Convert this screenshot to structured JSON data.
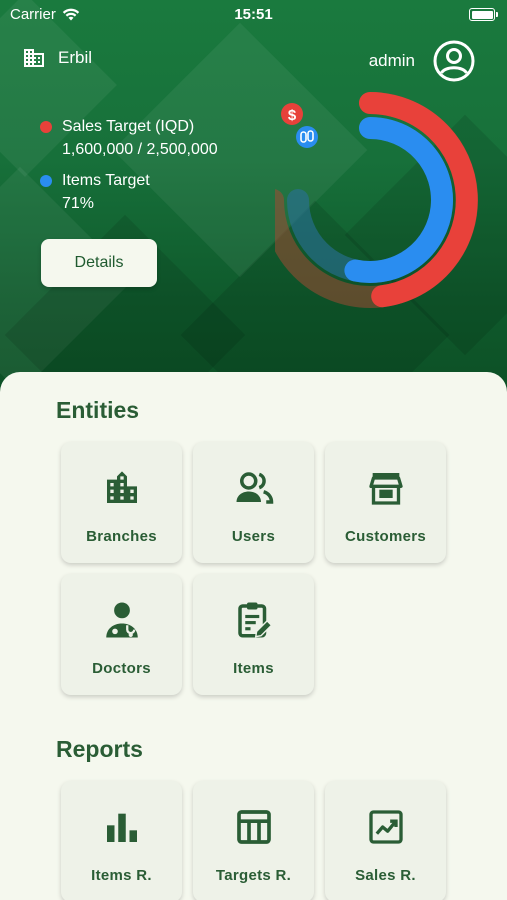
{
  "status_bar": {
    "carrier": "Carrier",
    "time": "15:51"
  },
  "header": {
    "branch": "Erbil",
    "username": "admin"
  },
  "targets": {
    "sales": {
      "label": "Sales Target (IQD)",
      "value": "1,600,000 / 2,500,000",
      "color": "#e8413a",
      "progress": 0.64
    },
    "items": {
      "label": "Items Target",
      "value": "71%",
      "color": "#2a8df0",
      "progress": 0.71
    },
    "details_button": "Details"
  },
  "entities": {
    "title": "Entities",
    "tiles": [
      {
        "label": "Branches",
        "icon": "building-icon"
      },
      {
        "label": "Users",
        "icon": "users-icon"
      },
      {
        "label": "Customers",
        "icon": "store-icon"
      },
      {
        "label": "Doctors",
        "icon": "doctor-icon"
      },
      {
        "label": "Items",
        "icon": "clipboard-edit-icon"
      }
    ]
  },
  "reports": {
    "title": "Reports",
    "tiles": [
      {
        "label": "Items R.",
        "icon": "bar-chart-icon"
      },
      {
        "label": "Targets R.",
        "icon": "table-icon"
      },
      {
        "label": "Sales R.",
        "icon": "trending-up-icon"
      }
    ]
  },
  "colors": {
    "primary": "#1a7a3e",
    "tile_text": "#2a5d35",
    "panel": "#f5f8ee"
  }
}
